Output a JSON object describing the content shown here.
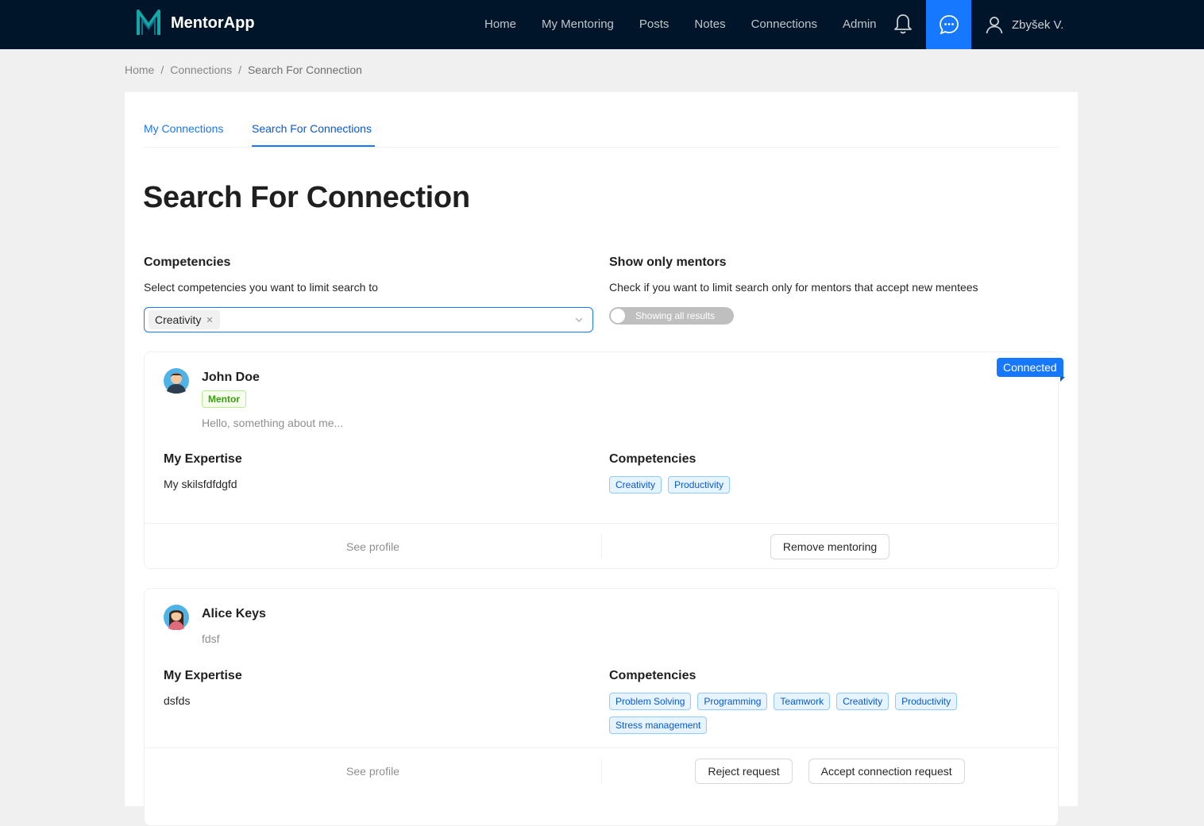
{
  "app": {
    "name": "MentorApp"
  },
  "nav": {
    "items": [
      {
        "label": "Home"
      },
      {
        "label": "My Mentoring"
      },
      {
        "label": "Posts"
      },
      {
        "label": "Notes"
      },
      {
        "label": "Connections"
      },
      {
        "label": "Admin"
      }
    ],
    "user_name": "Zbyšek V."
  },
  "breadcrumb": {
    "items": [
      "Home",
      "Connections",
      "Search For Connection"
    ]
  },
  "tabs": [
    {
      "label": "My Connections"
    },
    {
      "label": "Search For Connections",
      "active": true
    }
  ],
  "page": {
    "title": "Search For Connection"
  },
  "filters": {
    "competencies": {
      "title": "Competencies",
      "subtitle": "Select competencies you want to limit search to",
      "selected": [
        "Creativity"
      ]
    },
    "mentors_only": {
      "title": "Show only mentors",
      "subtitle": "Check if you want to limit search only for mentors that accept new mentees",
      "switch_label": "Showing all results",
      "checked": false
    }
  },
  "results": [
    {
      "name": "John Doe",
      "tag": "Mentor",
      "about": "Hello, something about me...",
      "ribbon": "Connected",
      "expertise_title": "My Expertise",
      "expertise": "My skilsfdfdgfd",
      "competencies_title": "Competencies",
      "competencies": [
        "Creativity",
        "Productivity"
      ],
      "see_profile": "See profile",
      "actions": [
        "Remove mentoring"
      ]
    },
    {
      "name": "Alice Keys",
      "about": "fdsf",
      "expertise_title": "My Expertise",
      "expertise": "dsfds",
      "competencies_title": "Competencies",
      "competencies": [
        "Problem Solving",
        "Programming",
        "Teamwork",
        "Creativity",
        "Productivity",
        "Stress management"
      ],
      "see_profile": "See profile",
      "actions": [
        "Reject request",
        "Accept connection request"
      ]
    }
  ],
  "colors": {
    "header_bg": "#001529",
    "primary": "#1677ff",
    "mentor_green": "#389e0d"
  }
}
